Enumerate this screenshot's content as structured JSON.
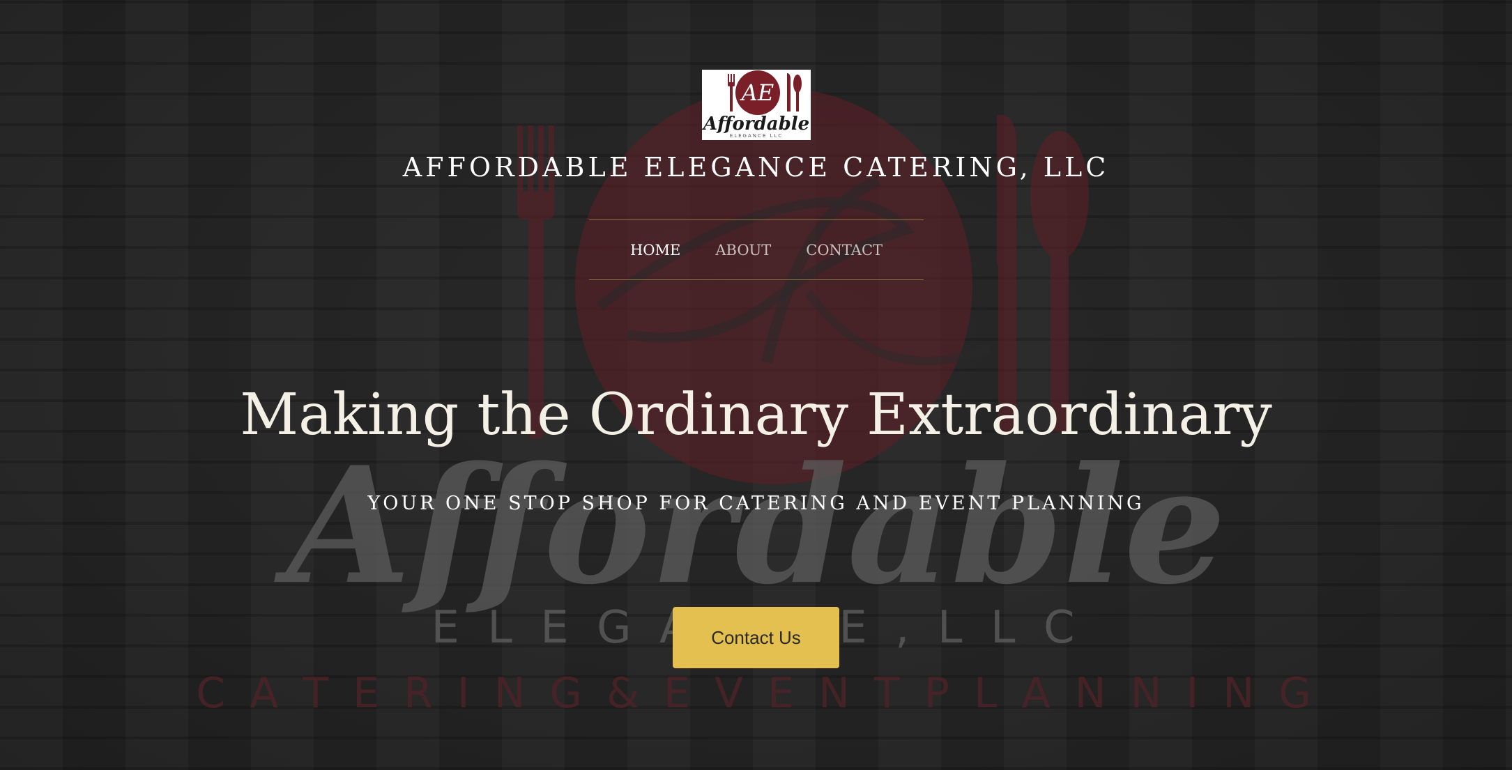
{
  "brand": {
    "logo_script": "Affordable",
    "logo_sub": "ELEGANCE LLC",
    "logo_monogram": "AE",
    "title": "AFFORDABLE ELEGANCE CATERING, LLC"
  },
  "nav": {
    "items": [
      {
        "label": "HOME",
        "active": true
      },
      {
        "label": "ABOUT",
        "active": false
      },
      {
        "label": "CONTACT",
        "active": false
      }
    ]
  },
  "hero": {
    "headline": "Making the Ordinary Extraordinary",
    "tagline": "YOUR ONE STOP SHOP FOR CATERING AND EVENT PLANNING",
    "cta_label": "Contact Us"
  },
  "watermark": {
    "script": "Affordable",
    "line1": "E L E G A N C E , L L C",
    "line2": "C A T E R I N G   &   E V E N T   P L A N N I N G"
  },
  "colors": {
    "background": "#242424",
    "accent_maroon": "#7a1e28",
    "button_gold": "#e3c04f",
    "nav_rule": "#8a7a4a"
  }
}
